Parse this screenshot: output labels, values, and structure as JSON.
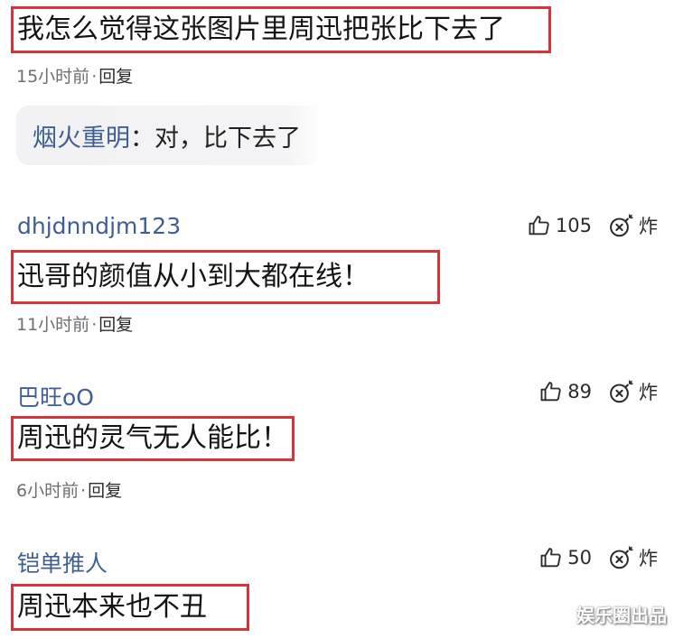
{
  "comments": [
    {
      "text": "我怎么觉得这张图片里周迅把张比下去了",
      "time": "15小时前",
      "sep": "·",
      "reply_label": "回复",
      "reply": {
        "name": "烟火重明",
        "colon": "：",
        "text": "对，比下去了"
      }
    },
    {
      "user": "dhjdnndjm123",
      "likes": "105",
      "bomb_label": "炸",
      "text": "迅哥的颜值从小到大都在线！",
      "time": "11小时前",
      "sep": "·",
      "reply_label": "回复"
    },
    {
      "user": "巴旺oO",
      "likes": "89",
      "bomb_label": "炸",
      "text": "周迅的灵气无人能比！",
      "time": "6小时前",
      "sep": "·",
      "reply_label": "回复"
    },
    {
      "user": "铠单推人",
      "likes": "50",
      "bomb_label": "炸",
      "text": "周迅本来也不丑"
    }
  ],
  "watermark": "娱乐圈出品",
  "colors": {
    "highlight_border": "#d6343a",
    "username": "#3f5f93",
    "meta": "#6e6e73"
  },
  "icons": {
    "like": "thumbs-up-icon",
    "bomb": "bomb-icon"
  }
}
